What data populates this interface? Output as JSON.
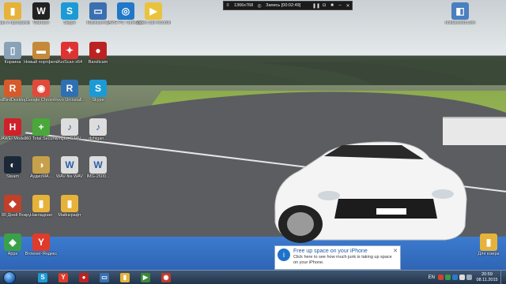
{
  "recorder": {
    "resolution": "1366x768",
    "status": "Запись [00:02:49]"
  },
  "desktop_icons": [
    {
      "key": "programs",
      "label": "Игры и программы",
      "color": "#e6b23a",
      "glyph": "▮"
    },
    {
      "key": "warface",
      "label": "Warface",
      "color": "#222222",
      "glyph": "W"
    },
    {
      "key": "skype",
      "label": "Skype",
      "color": "#1c9ad6",
      "glyph": "S"
    },
    {
      "key": "computer",
      "label": "Компьютер",
      "color": "#3a6fb0",
      "glyph": "▭"
    },
    {
      "key": "avg",
      "label": "AVG PC TuneUp 2015",
      "color": "#1f78c8",
      "glyph": "◎"
    },
    {
      "key": "video",
      "label": "Video call recording...",
      "color": "#e9c33d",
      "glyph": "▶"
    },
    {
      "key": "trash",
      "label": "Корзина",
      "color": "#8aa2b8",
      "glyph": "▯"
    },
    {
      "key": "portfolio",
      "label": "Новый портфель",
      "color": "#c48a3a",
      "glyph": "▬"
    },
    {
      "key": "yuxscan",
      "label": "YuxScan x64",
      "color": "#d33",
      "glyph": "✦"
    },
    {
      "key": "bandicam",
      "label": "Bandicam",
      "color": "#b22",
      "glyph": "●"
    },
    {
      "key": "redbird",
      "label": "RedBirdDesktop...",
      "color": "#d85a2a",
      "glyph": "R"
    },
    {
      "key": "chrome",
      "label": "Google Chrome",
      "color": "#e04a3a",
      "glyph": "◉"
    },
    {
      "key": "revo",
      "label": "Revo Uninstall...",
      "color": "#2f6fb3",
      "glyph": "R"
    },
    {
      "key": "skype2",
      "label": "Skype",
      "color": "#1c9ad6",
      "glyph": "S"
    },
    {
      "key": "huawei",
      "label": "HUAWEI Modem 3...",
      "color": "#d0202a",
      "glyph": "H"
    },
    {
      "key": "360",
      "label": "360 Total Security",
      "color": "#4aa83a",
      "glyph": "+"
    },
    {
      "key": "wingta",
      "label": "wingta_GTAV...",
      "color": "#dddddd",
      "glyph": "♪"
    },
    {
      "key": "dzhigan",
      "label": "dzhigan...",
      "color": "#dddddd",
      "glyph": "♪"
    },
    {
      "key": "steam",
      "label": "Steam",
      "color": "#1b2838",
      "glyph": "◐"
    },
    {
      "key": "audio",
      "label": "АудиоМА...",
      "color": "#c7a04a",
      "glyph": "◑"
    },
    {
      "key": "wav1",
      "label": "WAV-file WAV",
      "color": "#dddddd",
      "glyph": "W"
    },
    {
      "key": "wav2",
      "label": "IMG-2600...",
      "color": "#dddddd",
      "glyph": "W"
    },
    {
      "key": "days",
      "label": "За 80 Дней Вокруг С...",
      "color": "#c2402a",
      "glyph": "◆"
    },
    {
      "key": "tickets",
      "label": "Накладная",
      "color": "#e6b23a",
      "glyph": "▮"
    },
    {
      "key": "minecraft",
      "label": "Майнкрафт",
      "color": "#e6b23a",
      "glyph": "▮"
    },
    {
      "key": "apps",
      "label": "Apps",
      "color": "#3aa04a",
      "glyph": "◈"
    },
    {
      "key": "yandex",
      "label": "Browser-Яндекс",
      "color": "#e03a2a",
      "glyph": "Y"
    },
    {
      "key": "user",
      "label": "nokiaworld.com",
      "color": "#4a7fc0",
      "glyph": "◧"
    },
    {
      "key": "forwork",
      "label": "Для юзера",
      "color": "#e6b23a",
      "glyph": "▮"
    }
  ],
  "notification": {
    "title": "Free up space on your iPhone",
    "body": "Click here to see how much junk is taking up space on your iPhone."
  },
  "taskbar": {
    "buttons": [
      {
        "key": "skype",
        "glyph": "S",
        "color": "#1c9ad6"
      },
      {
        "key": "yandex",
        "glyph": "Y",
        "color": "#e03a2a"
      },
      {
        "key": "bandicam",
        "glyph": "●",
        "color": "#b22"
      },
      {
        "key": "explorer",
        "glyph": "▭",
        "color": "#3a6fb0"
      },
      {
        "key": "folder",
        "glyph": "▮",
        "color": "#e6b23a"
      },
      {
        "key": "media",
        "glyph": "▶",
        "color": "#3a8a3a"
      },
      {
        "key": "recorder",
        "glyph": "◉",
        "color": "#c0392b"
      }
    ],
    "language": "EN",
    "time": "20:59",
    "date": "08.11.2015"
  }
}
